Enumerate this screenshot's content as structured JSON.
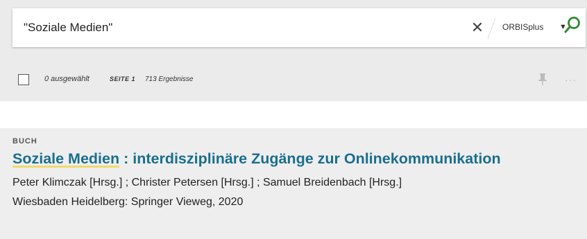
{
  "search": {
    "query": "\"Soziale Medien\"",
    "clear_symbol": "✕",
    "scope": "ORBISplus",
    "scope_caret": "▼",
    "search_icon": "magnifier-icon"
  },
  "toolbar": {
    "selected": "0 ausgewählt",
    "page": "SEITE 1",
    "count": "713 Ergebnisse",
    "pin_icon": "pin-icon",
    "more": "···"
  },
  "result": {
    "type": "BUCH",
    "title_highlight": "Soziale Medien",
    "title_rest": " : interdisziplinäre Zugänge zur Onlinekommunikation",
    "authors": "Peter Klimczak [Hrsg.] ; Christer Petersen [Hrsg.] ; Samuel Breidenbach [Hrsg.]",
    "publication": "Wiesbaden Heidelberg: Springer Vieweg, 2020"
  },
  "colors": {
    "title": "#1a6e8e",
    "highlight": "#f3d86a",
    "search_icon": "#2f8a2f",
    "band": "#ebebeb"
  }
}
